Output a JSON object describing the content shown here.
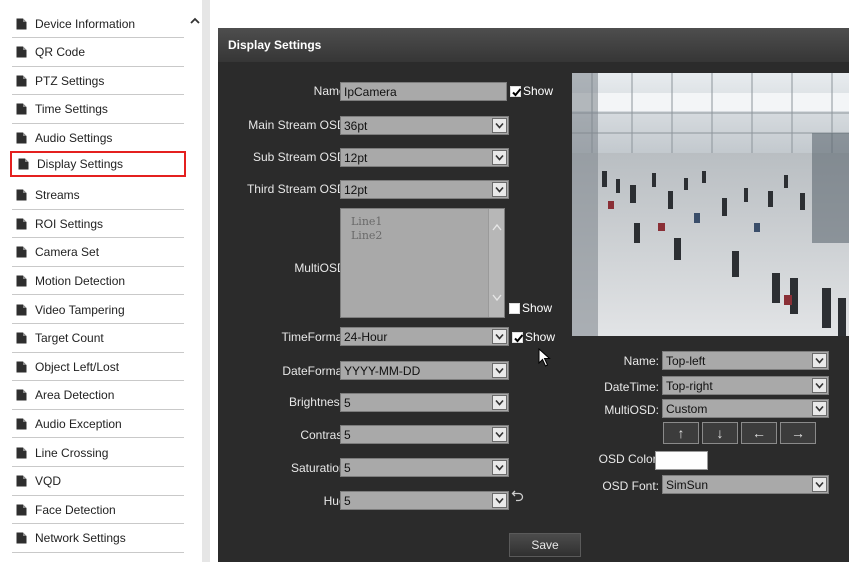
{
  "sidebar": {
    "items": [
      {
        "label": "Device Information"
      },
      {
        "label": "QR Code"
      },
      {
        "label": "PTZ Settings"
      },
      {
        "label": "Time Settings"
      },
      {
        "label": "Audio Settings"
      },
      {
        "label": "Display Settings",
        "active": true
      },
      {
        "label": "Streams"
      },
      {
        "label": "ROI Settings"
      },
      {
        "label": "Camera Set"
      },
      {
        "label": "Motion Detection"
      },
      {
        "label": "Video Tampering"
      },
      {
        "label": "Target Count"
      },
      {
        "label": "Object Left/Lost"
      },
      {
        "label": "Area Detection"
      },
      {
        "label": "Audio Exception"
      },
      {
        "label": "Line Crossing"
      },
      {
        "label": "VQD"
      },
      {
        "label": "Face Detection"
      },
      {
        "label": "Network Settings"
      }
    ]
  },
  "panel": {
    "title": "Display Settings"
  },
  "form": {
    "name_label": "Name:",
    "name_value": "IpCamera",
    "main_osd_label": "Main Stream OSD:",
    "main_osd_value": "36pt",
    "sub_osd_label": "Sub Stream OSD:",
    "sub_osd_value": "12pt",
    "third_osd_label": "Third Stream OSD:",
    "third_osd_value": "12pt",
    "multiosd_label": "MultiOSD:",
    "multiosd_lines": [
      "Line1",
      "Line2"
    ],
    "timeformat_label": "TimeFormat:",
    "timeformat_value": "24-Hour",
    "dateformat_label": "DateFormat:",
    "dateformat_value": "YYYY-MM-DD",
    "brightness_label": "Brightness:",
    "brightness_value": "5",
    "contrast_label": "Contrast:",
    "contrast_value": "5",
    "saturation_label": "Saturation:",
    "saturation_value": "5",
    "hue_label": "Hue:",
    "hue_value": "5",
    "show_label": "Show"
  },
  "osd_position": {
    "name_label": "Name:",
    "name_value": "Top-left",
    "datetime_label": "DateTime:",
    "datetime_value": "Top-right",
    "multiosd_label": "MultiOSD:",
    "multiosd_value": "Custom",
    "arrows": [
      "↑",
      "↓",
      "←",
      "→"
    ],
    "color_label": "OSD Color:",
    "color_value": "#ffffff",
    "font_label": "OSD Font:",
    "font_value": "SimSun"
  },
  "actions": {
    "save_label": "Save"
  },
  "colors": {
    "active_outline": "#e4201f",
    "panel_bg": "#2b2b2b"
  }
}
